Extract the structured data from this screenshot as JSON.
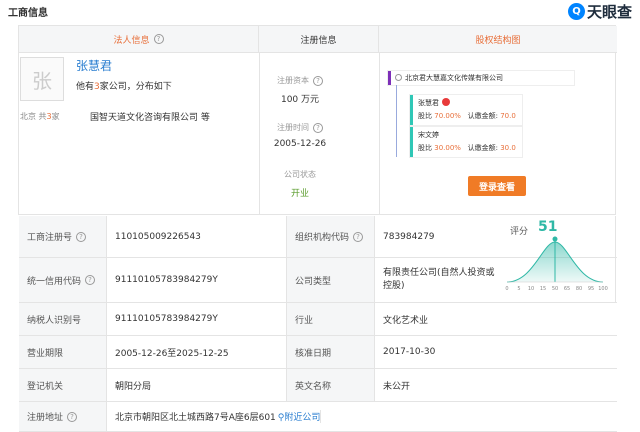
{
  "section_title": "工商信息",
  "logo": {
    "mark": "Q",
    "text": "天眼查"
  },
  "headers": {
    "legal": "法人信息",
    "registration": "注册信息",
    "equity": "股权结构图"
  },
  "legal": {
    "avatar_char": "张",
    "name": "张慧君",
    "desc_prefix": "他有",
    "desc_count": "3",
    "desc_suffix": "家公司，分布如下",
    "loc_prefix": "北京  共",
    "loc_count": "3",
    "loc_suffix": "家",
    "company": "国智天道文化咨询有限公司 等"
  },
  "registration": {
    "capital_label": "注册资本",
    "capital_value": "100 万元",
    "date_label": "注册时间",
    "date_value": "2005-12-26",
    "status_label": "公司状态",
    "status_value": "开业"
  },
  "equity": {
    "root": "北京君大慧嘉文化传媒有限公司",
    "holders": [
      {
        "name": "张慧君",
        "share_label": "股比",
        "share": "70.00%",
        "amount_label": "认缴金额",
        "amount": "70.0"
      },
      {
        "name": "宋文婷",
        "share_label": "股比",
        "share": "30.00%",
        "amount_label": "认缴金额",
        "amount": "30.0"
      }
    ],
    "login_button": "登录查看"
  },
  "score": {
    "label": "评分",
    "value": "51",
    "ticks": [
      "0",
      "5",
      "10",
      "15",
      "50",
      "65",
      "80",
      "95",
      "100"
    ],
    "accent": "#2fb8a6"
  },
  "table": {
    "reg_no_label": "工商注册号",
    "reg_no": "110105009226543",
    "org_code_label": "组织机构代码",
    "org_code": "783984279",
    "credit_label": "统一信用代码",
    "credit": "91110105783984279Y",
    "type_label": "公司类型",
    "type_value": "有限责任公司(自然人投资或控股)",
    "tax_label": "纳税人识别号",
    "tax": "91110105783984279Y",
    "industry_label": "行业",
    "industry": "文化艺术业",
    "term_label": "营业期限",
    "term": "2005-12-26至2025-12-25",
    "approve_label": "核准日期",
    "approve": "2017-10-30",
    "authority_label": "登记机关",
    "authority": "朝阳分局",
    "en_label": "英文名称",
    "en_name": "未公开",
    "address_label": "注册地址",
    "address": "北京市朝阳区北土城西路7号A座6层601",
    "nearby": "附近公司"
  }
}
